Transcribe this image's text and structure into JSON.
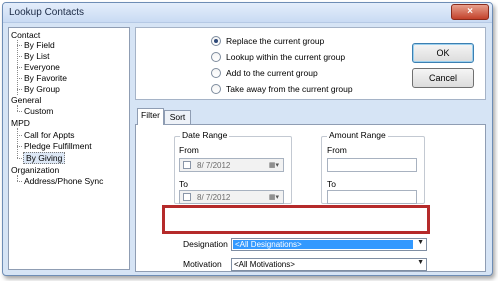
{
  "window": {
    "title": "Lookup Contacts",
    "close_glyph": "×"
  },
  "tree": {
    "groups": [
      {
        "label": "Contact",
        "items": [
          "By Field",
          "By List",
          "Everyone",
          "By Favorite",
          "By Group"
        ]
      },
      {
        "label": "General",
        "items": [
          "Custom"
        ]
      },
      {
        "label": "MPD",
        "items": [
          "Call for Appts",
          "Pledge Fulfillment",
          "By Giving"
        ]
      },
      {
        "label": "Organization",
        "items": [
          "Address/Phone Sync"
        ]
      }
    ],
    "selected": "By Giving"
  },
  "options": {
    "radios": [
      {
        "label": "Replace the current group",
        "checked": true
      },
      {
        "label": "Lookup within the current group",
        "checked": false
      },
      {
        "label": "Add to the current group",
        "checked": false
      },
      {
        "label": "Take away from the current group",
        "checked": false
      }
    ]
  },
  "buttons": {
    "ok": "OK",
    "cancel": "Cancel"
  },
  "tabs": [
    "Filter",
    "Sort"
  ],
  "filter": {
    "date_range": {
      "title": "Date Range",
      "from_label": "From",
      "from_value": "8/ 7/2012",
      "to_label": "To",
      "to_value": "8/ 7/2012"
    },
    "amount_range": {
      "title": "Amount Range",
      "from_label": "From",
      "from_value": "",
      "to_label": "To",
      "to_value": ""
    },
    "designation_label": "Designation",
    "designation_value": "<All Designations>",
    "motivation_label": "Motivation",
    "motivation_value": "<All Motivations>"
  },
  "icons": {
    "calendar": "calendar-icon",
    "dropdown": "chevron-down-icon"
  },
  "colors": {
    "highlight": "#b52a2a",
    "selection": "#3399ff",
    "window_bg": "#d6e4f5"
  }
}
